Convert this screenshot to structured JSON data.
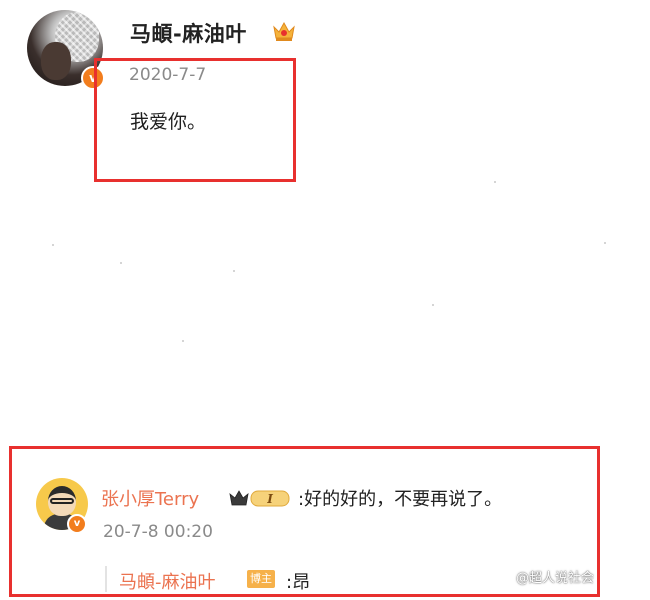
{
  "post": {
    "username": "马頔-麻油叶",
    "date": "2020-7-7",
    "text": "我爱你。",
    "verified_mark": "v"
  },
  "icons": {
    "main_avatar": "avatar",
    "verify": "verified-badge-icon",
    "crown": "crown-icon",
    "member_level": "vip-level-badge-icon"
  },
  "comment": {
    "username": "张小厚Terry",
    "member_level": "I",
    "text": ":好的好的，不要再说了。",
    "date": "20-7-8 00:20",
    "verified_mark": "v"
  },
  "reply": {
    "username": "马頔-麻油叶",
    "author_tag": "博主",
    "text": ":昂"
  },
  "watermark": {
    "text": "@超人说社会"
  },
  "colors": {
    "highlight_border": "#e8302e",
    "username_link": "#eb7350",
    "verify_orange": "#f27d1d",
    "author_tag_bg": "#f6b14a",
    "timestamp": "#8a8a8a"
  }
}
